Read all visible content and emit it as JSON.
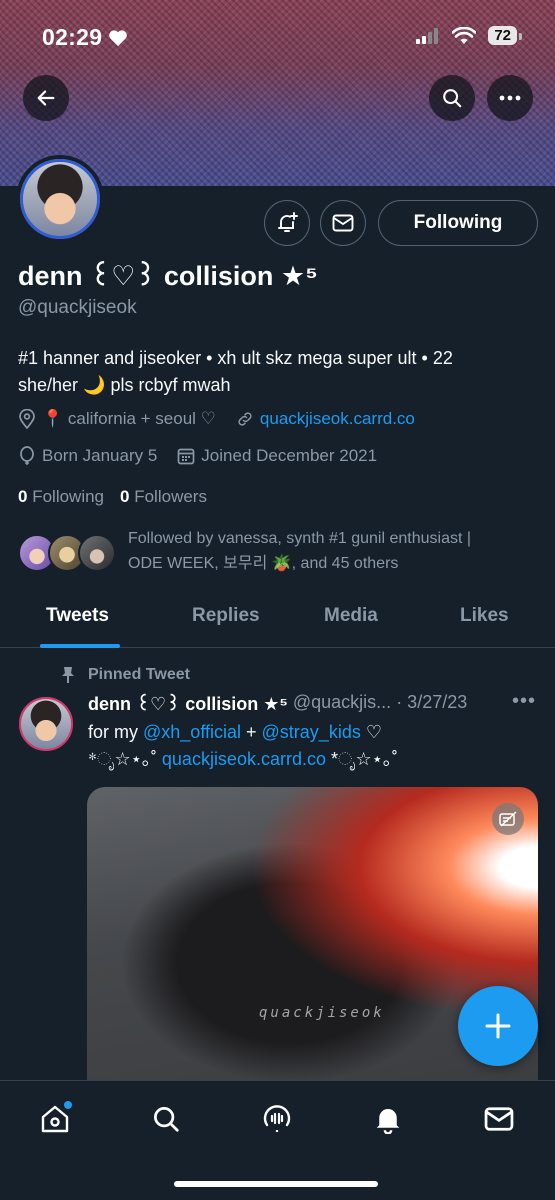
{
  "status_bar": {
    "time": "02:29",
    "battery": "72"
  },
  "colors": {
    "background": "#15202b",
    "accent": "#1d9bf0",
    "muted": "#8b98a5",
    "border": "#38444d"
  },
  "header_icons": [
    "back-arrow-icon",
    "search-icon",
    "more-icon"
  ],
  "profile": {
    "display_name": "denn ꒰♡꒱ collision ★⁵",
    "handle": "@quackjiseok",
    "bio_line1": "#1 hanner and jiseoker • xh ult skz mega super ult • 22",
    "bio_line2": "she/her 🌙 pls rcbyf mwah",
    "location": "📍 california + seoul ♡",
    "website": "quackjiseok.carrd.co",
    "birthday": "Born January 5",
    "joined": "Joined December 2021",
    "following_count": "0",
    "following_label": "Following",
    "followers_count": "0",
    "followers_label": "Followers",
    "followed_by_line1": "Followed by vanessa, synth #1 gunil enthusiast |",
    "followed_by_line2": "ODE WEEK, 보무리 🪴, and 45 others",
    "follow_button": "Following"
  },
  "tabs": [
    {
      "label": "Tweets",
      "active": true
    },
    {
      "label": "Replies",
      "active": false
    },
    {
      "label": "Media",
      "active": false
    },
    {
      "label": "Likes",
      "active": false
    }
  ],
  "pinned_tweet": {
    "pinned_label": "Pinned Tweet",
    "name": "denn ꒰♡꒱ collision ★⁵",
    "handle": "@quackjis...",
    "date": "· 3/27/23",
    "more": "•••",
    "text_prefix": "for my ",
    "mention1": "@xh_official",
    "text_mid": " + ",
    "mention2": "@stray_kids",
    "text_suffix": " ♡",
    "deco_left": "*ೃ☆⋆｡˚ ",
    "link": "quackjiseok.carrd.co",
    "deco_right": " *ೃ☆⋆｡˚",
    "watermark": "quackjiseok"
  },
  "bottom_nav": [
    "home-icon",
    "search-icon",
    "spaces-icon",
    "notifications-icon",
    "messages-icon"
  ]
}
